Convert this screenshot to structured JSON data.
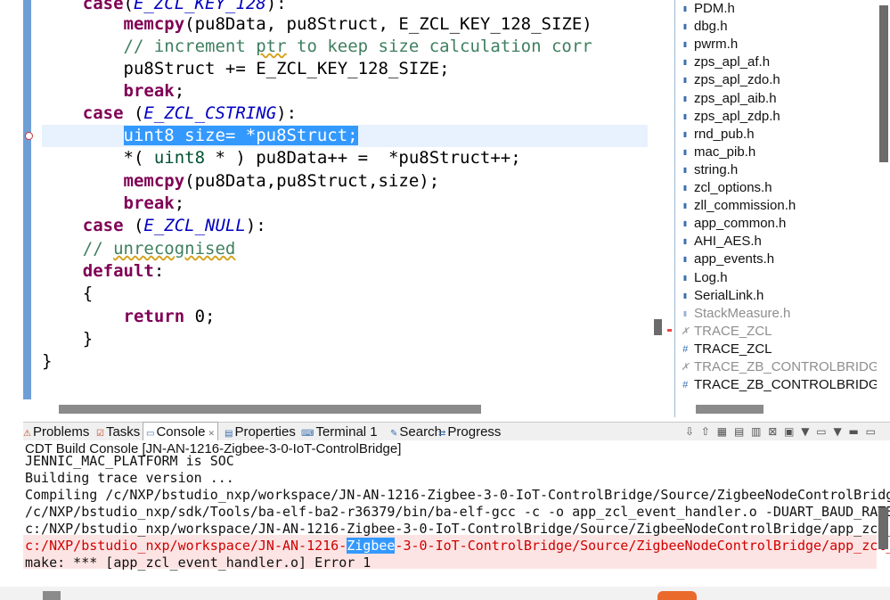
{
  "editor": {
    "lines": [
      {
        "pre": "    ",
        "parts": [
          [
            "kw",
            "case"
          ],
          [
            "t",
            "("
          ],
          [
            "it",
            "E_ZCL_KEY_128"
          ],
          [
            "t",
            "):"
          ]
        ]
      },
      {
        "pre": "        ",
        "parts": [
          [
            "kw",
            "memcpy"
          ],
          [
            "t",
            "(pu8Data, pu8Struct, E_ZCL_KEY_128_SIZE)"
          ]
        ]
      },
      {
        "pre": "        ",
        "parts": [
          [
            "cm",
            "// increment "
          ],
          [
            "cmsq",
            "ptr"
          ],
          [
            "cm",
            " to keep size calculation corr"
          ]
        ]
      },
      {
        "pre": "        ",
        "parts": [
          [
            "t",
            "pu8Struct += E_ZCL_KEY_128_SIZE;"
          ]
        ]
      },
      {
        "pre": "        ",
        "parts": [
          [
            "kw",
            "break"
          ],
          [
            "t",
            ";"
          ]
        ]
      },
      {
        "pre": "    ",
        "parts": [
          [
            "kw",
            "case"
          ],
          [
            "t",
            " ("
          ],
          [
            "it",
            "E_ZCL_CSTRING"
          ],
          [
            "t",
            "):"
          ]
        ]
      },
      {
        "pre": "        ",
        "parts": [
          [
            "sel",
            "uint8 size= *pu8Struct;"
          ]
        ]
      },
      {
        "pre": "        ",
        "parts": [
          [
            "t",
            "*( "
          ],
          [
            "type",
            "uint8"
          ],
          [
            "t",
            " * ) pu8Data++ =  *pu8Struct++;"
          ]
        ]
      },
      {
        "pre": "        ",
        "parts": [
          [
            "kw",
            "memcpy"
          ],
          [
            "t",
            "(pu8Data,pu8Struct,size);"
          ]
        ]
      },
      {
        "pre": "        ",
        "parts": [
          [
            "kw",
            "break"
          ],
          [
            "t",
            ";"
          ]
        ]
      },
      {
        "pre": "    ",
        "parts": [
          [
            "kw",
            "case"
          ],
          [
            "t",
            " ("
          ],
          [
            "it",
            "E_ZCL_NULL"
          ],
          [
            "t",
            "):"
          ]
        ]
      },
      {
        "pre": "    ",
        "parts": [
          [
            "cm",
            "// "
          ],
          [
            "cmsq",
            "unrecognised"
          ]
        ]
      },
      {
        "pre": "    ",
        "parts": [
          [
            "kw",
            "default"
          ],
          [
            "t",
            ":"
          ]
        ]
      },
      {
        "pre": "    ",
        "parts": [
          [
            "t",
            "{"
          ]
        ]
      },
      {
        "pre": "        ",
        "parts": [
          [
            "kw",
            "return"
          ],
          [
            "t",
            " 0;"
          ]
        ]
      },
      {
        "pre": "    ",
        "parts": [
          [
            "t",
            "}"
          ]
        ]
      },
      {
        "pre": "",
        "parts": [
          [
            "t",
            "}"
          ]
        ]
      }
    ]
  },
  "outline": {
    "items": [
      {
        "icon": "include-icon",
        "label": "PDM.h",
        "dim": false
      },
      {
        "icon": "include-icon",
        "label": "dbg.h",
        "dim": false
      },
      {
        "icon": "include-icon",
        "label": "pwrm.h",
        "dim": false
      },
      {
        "icon": "include-icon",
        "label": "zps_apl_af.h",
        "dim": false
      },
      {
        "icon": "include-icon",
        "label": "zps_apl_zdo.h",
        "dim": false
      },
      {
        "icon": "include-icon",
        "label": "zps_apl_aib.h",
        "dim": false
      },
      {
        "icon": "include-icon",
        "label": "zps_apl_zdp.h",
        "dim": false
      },
      {
        "icon": "include-icon",
        "label": "rnd_pub.h",
        "dim": false
      },
      {
        "icon": "include-icon",
        "label": "mac_pib.h",
        "dim": false
      },
      {
        "icon": "include-icon",
        "label": "string.h",
        "dim": false
      },
      {
        "icon": "include-icon",
        "label": "zcl_options.h",
        "dim": false
      },
      {
        "icon": "include-icon",
        "label": "zll_commission.h",
        "dim": false
      },
      {
        "icon": "include-icon",
        "label": "app_common.h",
        "dim": false
      },
      {
        "icon": "include-icon",
        "label": "AHI_AES.h",
        "dim": false
      },
      {
        "icon": "include-icon",
        "label": "app_events.h",
        "dim": false
      },
      {
        "icon": "include-icon",
        "label": "Log.h",
        "dim": false
      },
      {
        "icon": "include-icon",
        "label": "SerialLink.h",
        "dim": false
      },
      {
        "icon": "include-icon",
        "label": "StackMeasure.h",
        "dim": true
      },
      {
        "icon": "macro-undef-icon",
        "label": "TRACE_ZCL",
        "dim": true
      },
      {
        "icon": "macro-icon",
        "label": "TRACE_ZCL",
        "dim": false
      },
      {
        "icon": "macro-undef-icon",
        "label": "TRACE_ZB_CONTROLBRIDG",
        "dim": true
      },
      {
        "icon": "macro-icon",
        "label": "TRACE_ZB_CONTROLBRIDG",
        "dim": false
      }
    ]
  },
  "panel": {
    "tabs": [
      {
        "label": "Problems",
        "active": false
      },
      {
        "label": "Tasks",
        "active": false
      },
      {
        "label": "Console",
        "active": true
      },
      {
        "label": "Properties",
        "active": false
      },
      {
        "label": "Terminal 1",
        "active": false
      },
      {
        "label": "Search",
        "active": false
      },
      {
        "label": "Progress",
        "active": false
      }
    ],
    "console_title": "CDT Build Console [JN-AN-1216-Zigbee-3-0-IoT-ControlBridge]",
    "lines": [
      {
        "text": "JENNIC_MAC_PLATFORM is SOC",
        "err": false
      },
      {
        "text": "Building trace version ...",
        "err": false
      },
      {
        "text": "Compiling /c/NXP/bstudio_nxp/workspace/JN-AN-1216-Zigbee-3-0-IoT-ControlBridge/Source/ZigbeeNodeControlBridg",
        "err": false
      },
      {
        "text": "/c/NXP/bstudio_nxp/sdk/Tools/ba-elf-ba2-r36379/bin/ba-elf-gcc -c -o app_zcl_event_handler.o -DUART_BAUD_RATE",
        "err": false
      },
      {
        "text": "c:/NXP/bstudio_nxp/workspace/JN-AN-1216-Zigbee-3-0-IoT-ControlBridge/Source/ZigbeeNodeControlBridge/app_zcl_",
        "err": false
      },
      {
        "text": "c:/NXP/bstudio_nxp/workspace/JN-AN-1216-Zigbee-3-0-IoT-ControlBridge/Source/ZigbeeNodeControlBridge/app_zcl_",
        "err": true,
        "highlight": "Zigbee"
      },
      {
        "text": "make: *** [app_zcl_event_handler.o] Error 1",
        "err": false
      }
    ]
  },
  "colors": {
    "accent": "#6f9ed6",
    "selection": "#3399ff",
    "error": "#d00000"
  }
}
